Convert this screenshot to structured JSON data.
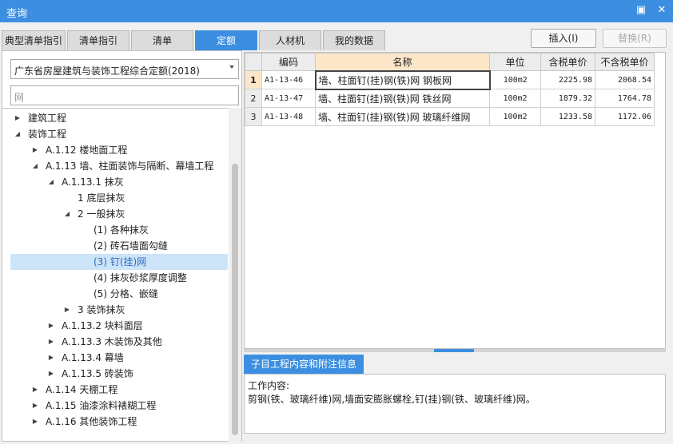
{
  "window": {
    "title": "查询",
    "restore_glyph": "▣",
    "close_glyph": "✕"
  },
  "tabs": [
    {
      "label": "典型清单指引",
      "active": false
    },
    {
      "label": "清单指引",
      "active": false
    },
    {
      "label": "清单",
      "active": false
    },
    {
      "label": "定额",
      "active": true
    },
    {
      "label": "人材机",
      "active": false
    },
    {
      "label": "我的数据",
      "active": false
    }
  ],
  "toolbar": {
    "insert_label": "插入(I)",
    "replace_label": "替换(R)"
  },
  "left": {
    "library_select": "广东省房屋建筑与装饰工程综合定额(2018)",
    "search_placeholder": "网",
    "tree": [
      {
        "label": "建筑工程",
        "toggle": "▶"
      },
      {
        "label": "装饰工程",
        "toggle": "◢"
      },
      {
        "label": "A.1.12 楼地面工程",
        "toggle": "▶"
      },
      {
        "label": "A.1.13 墙、柱面装饰与隔断、幕墙工程",
        "toggle": "◢"
      },
      {
        "label": "A.1.13.1 抹灰",
        "toggle": "◢"
      },
      {
        "label": "1 底层抹灰",
        "toggle": ""
      },
      {
        "label": "2 一般抹灰",
        "toggle": "◢"
      },
      {
        "label": "(1) 各种抹灰",
        "toggle": ""
      },
      {
        "label": "(2) 砖石墙面勾缝",
        "toggle": ""
      },
      {
        "label": "(3) 钉(挂)网",
        "toggle": "",
        "selected": true
      },
      {
        "label": "(4) 抹灰砂浆厚度调整",
        "toggle": ""
      },
      {
        "label": "(5) 分格、嵌缝",
        "toggle": ""
      },
      {
        "label": "3 装饰抹灰",
        "toggle": "▶"
      },
      {
        "label": "A.1.13.2 块料面层",
        "toggle": "▶"
      },
      {
        "label": "A.1.13.3 木装饰及其他",
        "toggle": "▶"
      },
      {
        "label": "A.1.13.4 幕墙",
        "toggle": "▶"
      },
      {
        "label": "A.1.13.5 砖装饰",
        "toggle": "▶"
      },
      {
        "label": "A.1.14 天棚工程",
        "toggle": "▶"
      },
      {
        "label": "A.1.15 油漆涂料裱糊工程",
        "toggle": "▶"
      },
      {
        "label": "A.1.16 其他装饰工程",
        "toggle": "▶"
      }
    ]
  },
  "grid": {
    "headers": {
      "code": "编码",
      "name": "名称",
      "unit": "单位",
      "tax_price": "含税单价",
      "notax_price": "不含税单价"
    },
    "rows": [
      {
        "no": "1",
        "code": "A1-13-46",
        "name": "墙、柱面钉(挂)钢(铁)网 钢板网",
        "unit": "100m2",
        "tax_price": "2225.98",
        "notax_price": "2068.54"
      },
      {
        "no": "2",
        "code": "A1-13-47",
        "name": "墙、柱面钉(挂)钢(铁)网 铁丝网",
        "unit": "100m2",
        "tax_price": "1879.32",
        "notax_price": "1764.78"
      },
      {
        "no": "3",
        "code": "A1-13-48",
        "name": "墙、柱面钉(挂)钢(铁)网 玻璃纤维网",
        "unit": "100m2",
        "tax_price": "1233.58",
        "notax_price": "1172.06"
      }
    ]
  },
  "detail": {
    "tab_label": "子目工程内容和附注信息",
    "heading": "工作内容:",
    "content": "剪钢(铁、玻璃纤维)网,墙面安膨胀螺栓,钉(挂)钢(铁、玻璃纤维)网。"
  },
  "colors": {
    "accent": "#3c8fe0",
    "selection": "#cce4f7",
    "header_highlight": "#fbe6c8"
  }
}
